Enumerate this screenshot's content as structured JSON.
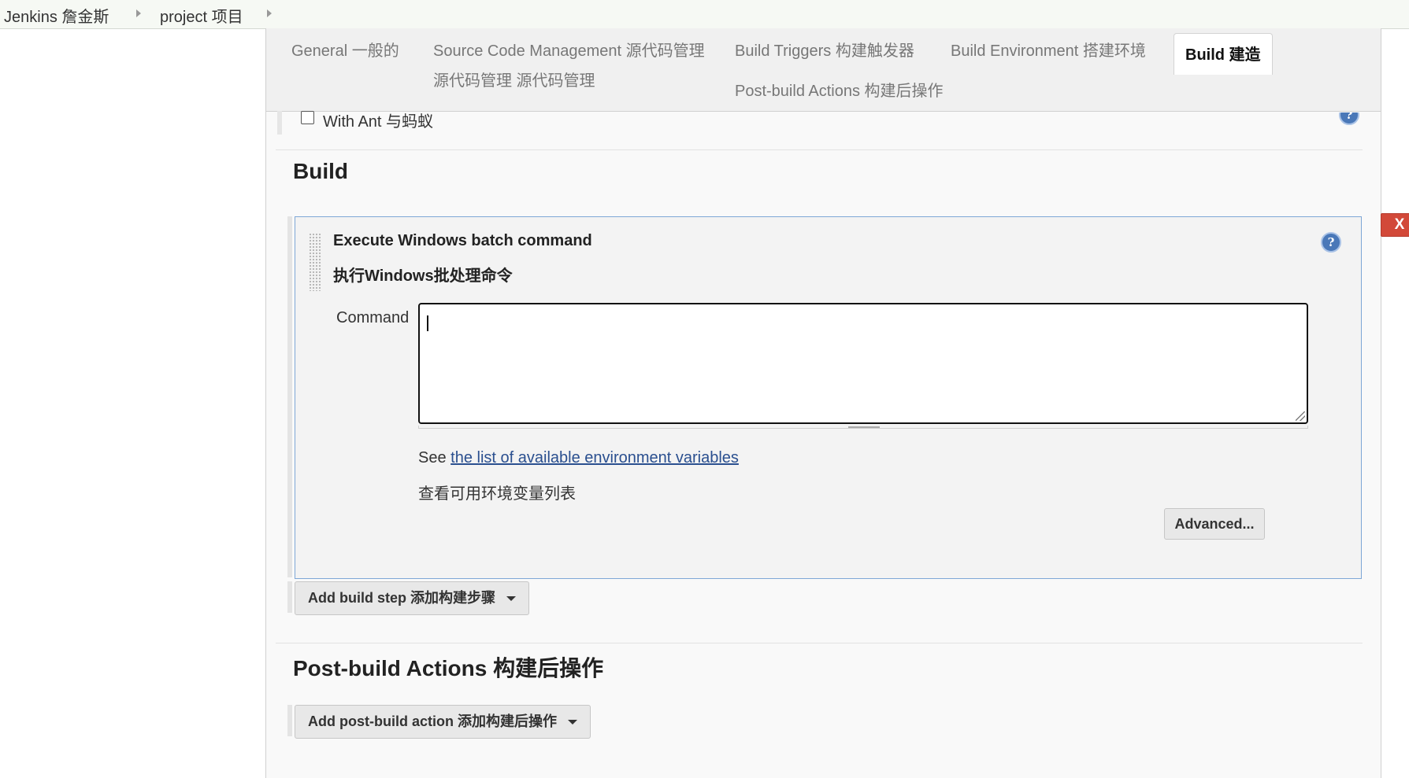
{
  "breadcrumb": {
    "items": [
      "Jenkins  詹金斯",
      "project 项目"
    ]
  },
  "tabs": {
    "general": "General 一般的",
    "scm": "Source Code Management 源代码管理",
    "scm_line2": "源代码管理 源代码管理",
    "triggers": "Build Triggers  构建触发器",
    "post_build": "Post-build Actions  构建后操作",
    "environment": "Build Environment   搭建环境",
    "build": "Build 建造"
  },
  "partial_option": {
    "label": "With Ant 与蚂蚁"
  },
  "build_section": {
    "title": "Build",
    "step": {
      "title_en": "Execute Windows batch command",
      "title_cn": "执行Windows批处理命令",
      "delete_label": "X",
      "command_label": "Command",
      "command_value": "",
      "see_prefix": "See ",
      "see_link": "the list of available environment variables",
      "see_cn": "查看可用环境变量列表",
      "advanced_label": "Advanced..."
    },
    "add_step_label": "Add build step 添加构建步骤"
  },
  "post_build_section": {
    "title": "Post-build Actions 构建后操作",
    "add_action_label": "Add post-build action 添加构建后操作"
  },
  "icons": {
    "help": "?"
  },
  "colors": {
    "delete_button": "#d24939",
    "link": "#2a4f8f",
    "step_border": "#7ea7d6"
  }
}
